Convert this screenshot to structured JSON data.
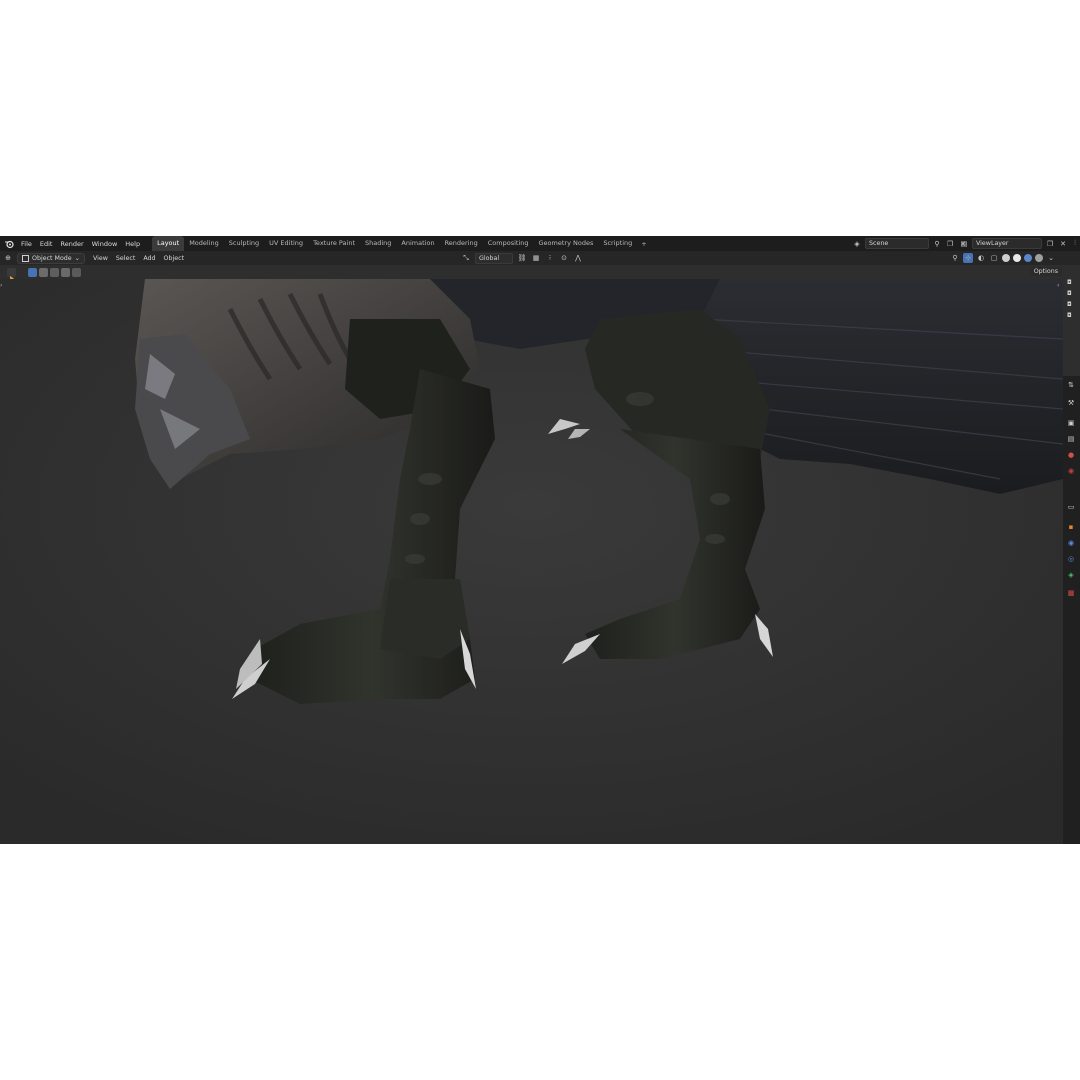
{
  "menu": [
    "File",
    "Edit",
    "Render",
    "Window",
    "Help"
  ],
  "workspace_tabs": [
    "Layout",
    "Modeling",
    "Sculpting",
    "UV Editing",
    "Texture Paint",
    "Shading",
    "Animation",
    "Rendering",
    "Compositing",
    "Geometry Nodes",
    "Scripting"
  ],
  "active_tab": "Layout",
  "add_tab": "+",
  "scene": "Scene",
  "view_layer": "ViewLayer",
  "header": {
    "mode": "Object Mode",
    "view": "View",
    "select": "Select",
    "add": "Add",
    "object": "Object",
    "transform_orientation": "Global"
  },
  "options_label": "Options",
  "colors": {
    "topbar": "#1d1d1d",
    "header": "#262626",
    "viewport": "#2e2e2e",
    "accent": "#4772b3"
  }
}
